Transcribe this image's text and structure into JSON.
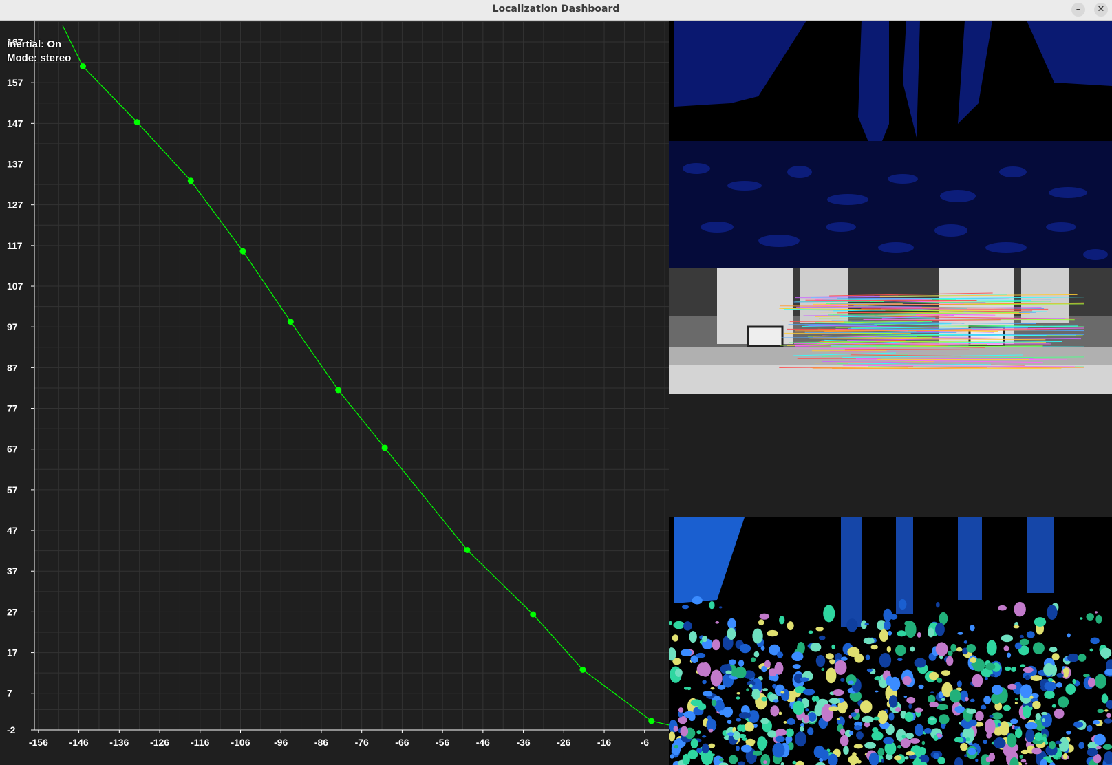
{
  "window": {
    "title": "Localization Dashboard",
    "minimize_icon": "minimize-icon",
    "close_icon": "close-icon"
  },
  "overlay": {
    "inertial": "Inertial: On",
    "mode": "Mode: stereo"
  },
  "colors": {
    "background": "#1f1f1f",
    "grid": "#333333",
    "trajectory": "#00ff00",
    "axis_text": "#ffffff",
    "depth_blue": "#0b1a6e",
    "flow_blue": "#1a5fd0",
    "flow_green": "#2fd6a0"
  },
  "chart_data": {
    "type": "line",
    "title": "",
    "xlabel": "",
    "ylabel": "",
    "grid": true,
    "xlim": [
      -157,
      0
    ],
    "ylim": [
      -2,
      167
    ],
    "x_ticks": [
      -156,
      -146,
      -136,
      -126,
      -116,
      -106,
      -96,
      -86,
      -76,
      -66,
      -56,
      -46,
      -36,
      -26,
      -16,
      -6
    ],
    "y_ticks": [
      167,
      157,
      147,
      137,
      127,
      117,
      107,
      97,
      87,
      77,
      67,
      57,
      47,
      37,
      27,
      17,
      7,
      -2
    ],
    "series": [
      {
        "line": [
          [
            -150,
            171
          ],
          [
            -145,
            161
          ],
          [
            -131.6,
            147.3
          ],
          [
            -118.3,
            132.9
          ],
          [
            -105.4,
            115.6
          ],
          [
            -93.6,
            98.3
          ],
          [
            -81.8,
            81.5
          ],
          [
            -70.3,
            67.3
          ],
          [
            -49.9,
            42.2
          ],
          [
            -33.6,
            26.4
          ],
          [
            -21.3,
            12.8
          ],
          [
            -4.3,
            0.2
          ],
          [
            0,
            -0.8
          ]
        ],
        "markers": [
          [
            -145,
            161
          ],
          [
            -131.6,
            147.3
          ],
          [
            -118.3,
            132.9
          ],
          [
            -105.4,
            115.6
          ],
          [
            -93.6,
            98.3
          ],
          [
            -81.8,
            81.5
          ],
          [
            -70.3,
            67.3
          ],
          [
            -49.9,
            42.2
          ],
          [
            -33.6,
            26.4
          ],
          [
            -21.3,
            12.8
          ],
          [
            -4.3,
            0.2
          ]
        ]
      }
    ]
  },
  "panels": {
    "depth": "depth-map-panel",
    "matches": "feature-matches-panel",
    "flow": "optical-flow-panel"
  }
}
